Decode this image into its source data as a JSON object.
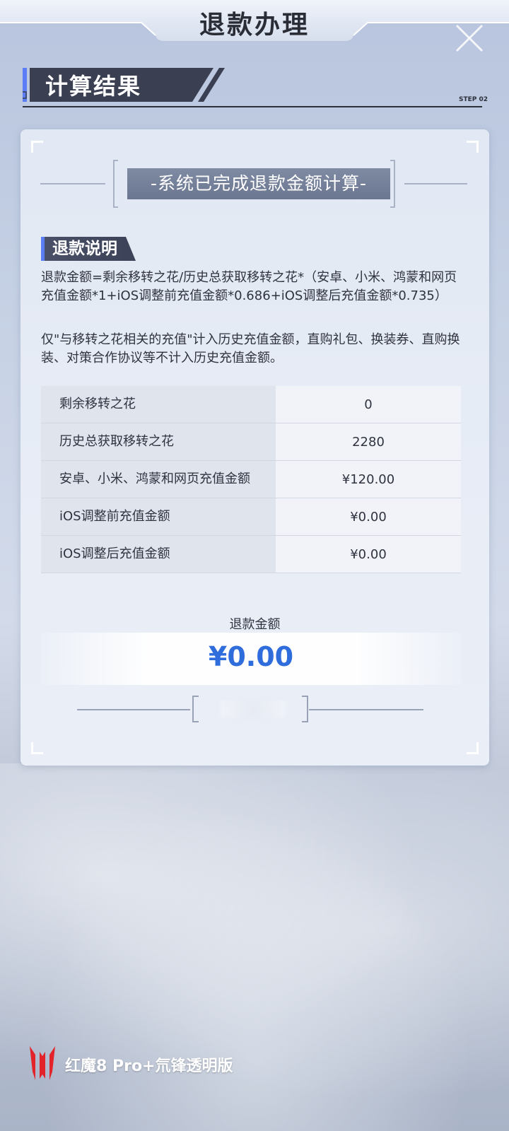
{
  "header": {
    "title": "退款办理"
  },
  "section": {
    "title": "计算结果",
    "step": "STEP 02"
  },
  "card": {
    "banner": "-系统已完成退款金额计算-",
    "explain_title": "退款说明",
    "formula": "退款金额=剩余移转之花/历史总获取移转之花*（安卓、小米、鸿蒙和网页充值金额*1+iOS调整前充值金额*0.686+iOS调整后充值金额*0.735）",
    "note": "仅\"与移转之花相关的充值\"计入历史充值金额，直购礼包、换装券、直购换装、对策合作协议等不计入历史充值金额。",
    "rows": [
      {
        "label": "剩余移转之花",
        "value": "0"
      },
      {
        "label": "历史总获取移转之花",
        "value": "2280"
      },
      {
        "label": "安卓、小米、鸿蒙和网页充值金额",
        "value": "¥120.00"
      },
      {
        "label": "iOS调整前充值金额",
        "value": "¥0.00"
      },
      {
        "label": "iOS调整后充值金额",
        "value": "¥0.00"
      }
    ],
    "amount_label": "退款金额",
    "amount_value": "¥0.00"
  },
  "watermark": {
    "text": "红魔8 Pro+氘锋透明版"
  },
  "colors": {
    "accent_blue": "#2f6ddc",
    "header_dark": "#3d4358",
    "marker_blue": "#5b7df5"
  }
}
